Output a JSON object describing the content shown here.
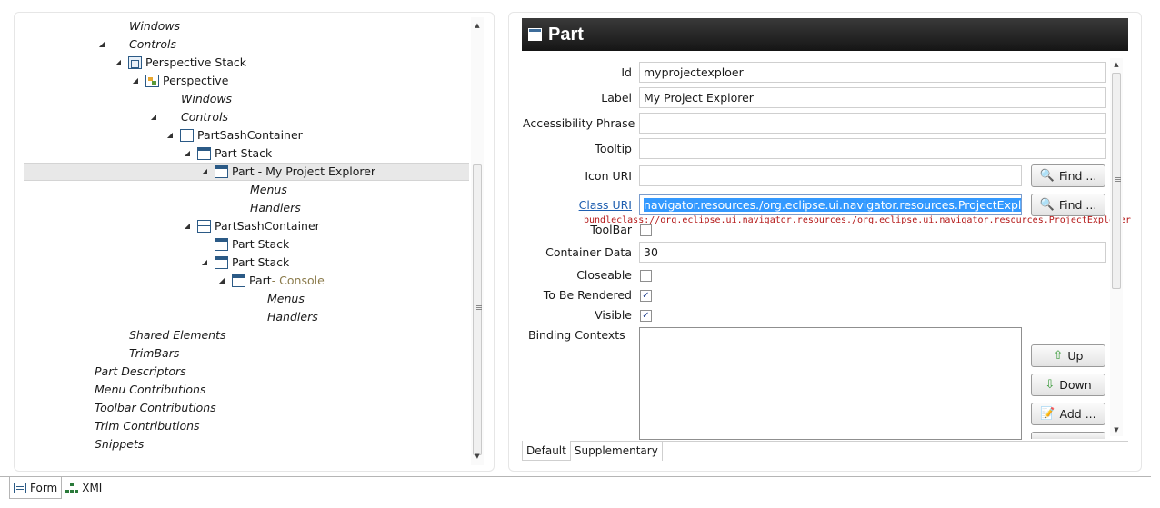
{
  "tree": {
    "rows": [
      {
        "label": "Windows",
        "italic": true,
        "indent": 127,
        "twisty": "",
        "icon": ""
      },
      {
        "label": "Controls",
        "italic": true,
        "indent": 127,
        "twisty": "◢",
        "icon": ""
      },
      {
        "label": "Perspective Stack",
        "italic": false,
        "indent": 145,
        "twisty": "◢",
        "icon": "perspective-stack-icon"
      },
      {
        "label": "Perspective",
        "italic": false,
        "indent": 164,
        "twisty": "◢",
        "icon": "perspective-icon"
      },
      {
        "label": "Windows",
        "italic": true,
        "indent": 184,
        "twisty": "",
        "icon": ""
      },
      {
        "label": "Controls",
        "italic": true,
        "indent": 184,
        "twisty": "◢",
        "icon": ""
      },
      {
        "label": "PartSashContainer",
        "italic": false,
        "indent": 202,
        "twisty": "◢",
        "icon": "part-sash-container-vertical-icon"
      },
      {
        "label": "Part Stack",
        "italic": false,
        "indent": 221,
        "twisty": "◢",
        "icon": "part-stack-icon"
      },
      {
        "label": "Part - My Project Explorer",
        "italic": false,
        "indent": 240,
        "twisty": "◢",
        "icon": "part-icon",
        "selected": true
      },
      {
        "label": "Menus",
        "italic": true,
        "indent": 260,
        "twisty": "",
        "icon": ""
      },
      {
        "label": "Handlers",
        "italic": true,
        "indent": 260,
        "twisty": "",
        "icon": ""
      },
      {
        "label": "PartSashContainer",
        "italic": false,
        "indent": 221,
        "twisty": "◢",
        "icon": "part-sash-container-horizontal-icon"
      },
      {
        "label": "Part Stack",
        "italic": false,
        "indent": 240,
        "twisty": "",
        "icon": "part-stack-icon"
      },
      {
        "label": "Part Stack",
        "italic": false,
        "indent": 240,
        "twisty": "◢",
        "icon": "part-stack-icon"
      },
      {
        "label": "Part",
        "suffix": " - Console",
        "italic": false,
        "indent": 259,
        "twisty": "◢",
        "icon": "part-icon"
      },
      {
        "label": "Menus",
        "italic": true,
        "indent": 279,
        "twisty": "",
        "icon": ""
      },
      {
        "label": "Handlers",
        "italic": true,
        "indent": 279,
        "twisty": "",
        "icon": ""
      },
      {
        "label": "Shared Elements",
        "italic": true,
        "indent": 127,
        "twisty": "",
        "icon": ""
      },
      {
        "label": "TrimBars",
        "italic": true,
        "indent": 127,
        "twisty": "",
        "icon": ""
      },
      {
        "label": "Part Descriptors",
        "italic": true,
        "indent": 89,
        "twisty": "",
        "icon": ""
      },
      {
        "label": "Menu Contributions",
        "italic": true,
        "indent": 89,
        "twisty": "",
        "icon": ""
      },
      {
        "label": "Toolbar Contributions",
        "italic": true,
        "indent": 89,
        "twisty": "",
        "icon": ""
      },
      {
        "label": "Trim Contributions",
        "italic": true,
        "indent": 89,
        "twisty": "",
        "icon": ""
      },
      {
        "label": "Snippets",
        "italic": true,
        "indent": 89,
        "twisty": "",
        "icon": ""
      }
    ]
  },
  "editor": {
    "title": "Part",
    "labels": {
      "id": "Id",
      "label": "Label",
      "accessibility": "Accessibility Phrase",
      "tooltip": "Tooltip",
      "icon_uri": "Icon URI",
      "class_uri": "Class URI",
      "toolbar": "ToolBar",
      "container_data": "Container Data",
      "closeable": "Closeable",
      "to_be_rendered": "To Be Rendered",
      "visible": "Visible",
      "binding_contexts": "Binding Contexts"
    },
    "values": {
      "id": "myprojectexploer",
      "label": "My Project Explorer",
      "accessibility": "",
      "tooltip": "",
      "icon_uri": "",
      "class_uri": "navigator.resources./org.eclipse.ui.navigator.resources.ProjectExplorer",
      "container_data": "30"
    },
    "bundle_hint": "bundleclass://org.eclipse.ui.navigator.resources./org.eclipse.ui.navigator.resources.ProjectExplorer",
    "checkboxes": {
      "toolbar": false,
      "closeable": false,
      "to_be_rendered": true,
      "visible": true
    },
    "buttons": {
      "find": "Find ...",
      "up": "Up",
      "down": "Down",
      "add": "Add ..."
    },
    "tabs": [
      "Default",
      "Supplementary"
    ],
    "active_tab": "Default"
  },
  "bottom_tabs": [
    "Form",
    "XMI"
  ],
  "active_bottom_tab": "Form"
}
